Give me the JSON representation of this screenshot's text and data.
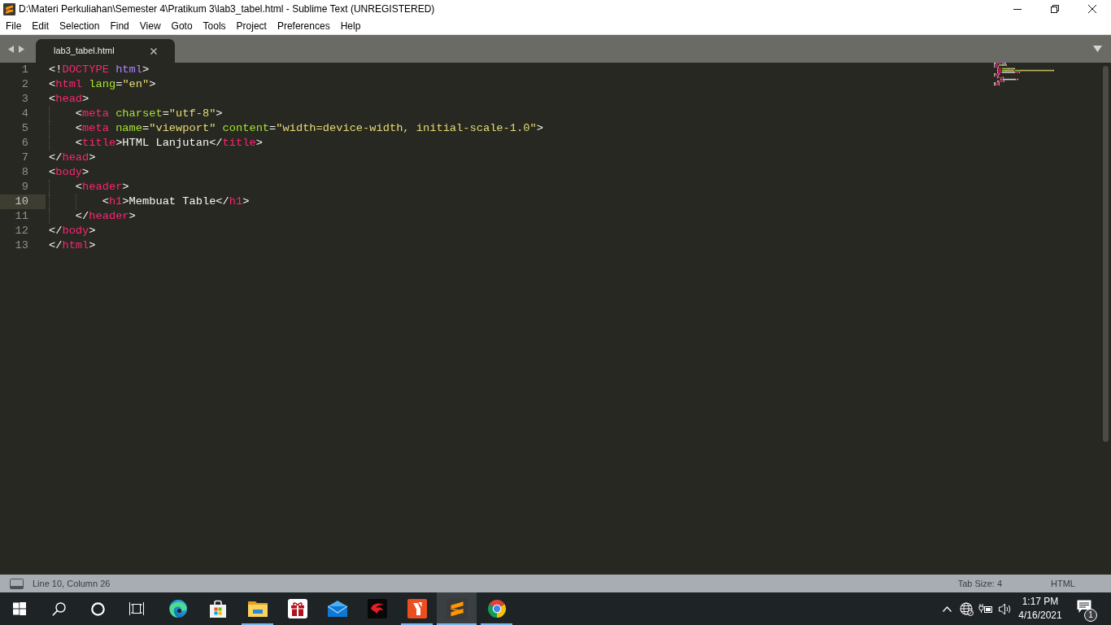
{
  "window": {
    "title": "D:\\Materi Perkuliahan\\Semester 4\\Pratikum 3\\lab3_tabel.html - Sublime Text (UNREGISTERED)"
  },
  "menu": [
    "File",
    "Edit",
    "Selection",
    "Find",
    "View",
    "Goto",
    "Tools",
    "Project",
    "Preferences",
    "Help"
  ],
  "tabs": [
    {
      "label": "lab3_tabel.html",
      "selected": true
    }
  ],
  "code": {
    "lines": [
      {
        "number": "1",
        "current": false,
        "tokens": [
          {
            "kind": "punct",
            "text": "<!"
          },
          {
            "kind": "tag",
            "text": "DOCTYPE"
          },
          {
            "kind": "keyword",
            "text": " html"
          },
          {
            "kind": "punct",
            "text": ">"
          }
        ]
      },
      {
        "number": "2",
        "current": false,
        "tokens": [
          {
            "kind": "punct",
            "text": "<"
          },
          {
            "kind": "tag",
            "text": "html"
          },
          {
            "kind": "attr",
            "text": " lang"
          },
          {
            "kind": "punct",
            "text": "="
          },
          {
            "kind": "string",
            "text": "\"en\""
          },
          {
            "kind": "punct",
            "text": ">"
          }
        ]
      },
      {
        "number": "3",
        "current": false,
        "tokens": [
          {
            "kind": "punct",
            "text": "<"
          },
          {
            "kind": "tag",
            "text": "head"
          },
          {
            "kind": "punct",
            "text": ">"
          }
        ],
        "children": [
          {
            "number": "4",
            "current": false,
            "tokens": [
              {
                "kind": "punct",
                "text": "<"
              },
              {
                "kind": "tag",
                "text": "meta"
              },
              {
                "kind": "attr",
                "text": " charset"
              },
              {
                "kind": "punct",
                "text": "="
              },
              {
                "kind": "string",
                "text": "\"utf-8\""
              },
              {
                "kind": "punct",
                "text": ">"
              }
            ]
          },
          {
            "number": "5",
            "current": false,
            "tokens": [
              {
                "kind": "punct",
                "text": "<"
              },
              {
                "kind": "tag",
                "text": "meta"
              },
              {
                "kind": "attr",
                "text": " name"
              },
              {
                "kind": "punct",
                "text": "="
              },
              {
                "kind": "string",
                "text": "\"viewport\""
              },
              {
                "kind": "attr",
                "text": " content"
              },
              {
                "kind": "punct",
                "text": "="
              },
              {
                "kind": "string",
                "text": "\"width=device-width, initial-scale-1.0\""
              },
              {
                "kind": "punct",
                "text": ">"
              }
            ]
          },
          {
            "number": "6",
            "current": false,
            "tokens": [
              {
                "kind": "punct",
                "text": "<"
              },
              {
                "kind": "tag",
                "text": "title"
              },
              {
                "kind": "punct",
                "text": ">"
              },
              {
                "kind": "text",
                "text": "HTML Lanjutan"
              },
              {
                "kind": "punct",
                "text": "</"
              },
              {
                "kind": "tag",
                "text": "title"
              },
              {
                "kind": "punct",
                "text": ">"
              }
            ]
          }
        ]
      },
      {
        "number": "7",
        "current": false,
        "tokens": [
          {
            "kind": "punct",
            "text": "</"
          },
          {
            "kind": "tag",
            "text": "head"
          },
          {
            "kind": "punct",
            "text": ">"
          }
        ]
      },
      {
        "number": "8",
        "current": false,
        "tokens": [
          {
            "kind": "punct",
            "text": "<"
          },
          {
            "kind": "tag",
            "text": "body"
          },
          {
            "kind": "punct",
            "text": ">"
          }
        ],
        "children": [
          {
            "number": "9",
            "current": false,
            "tokens": [
              {
                "kind": "punct",
                "text": "<"
              },
              {
                "kind": "tag",
                "text": "header"
              },
              {
                "kind": "punct",
                "text": ">"
              }
            ],
            "children": [
              {
                "number": "10",
                "current": true,
                "tokens": [
                  {
                    "kind": "punct",
                    "text": "<"
                  },
                  {
                    "kind": "tag",
                    "text": "h1"
                  },
                  {
                    "kind": "punct",
                    "text": ">"
                  },
                  {
                    "kind": "text",
                    "text": "Membuat Table"
                  },
                  {
                    "kind": "punct",
                    "text": "</"
                  },
                  {
                    "kind": "tag",
                    "text": "h1"
                  },
                  {
                    "kind": "punct",
                    "text": ">"
                  }
                ]
              }
            ]
          },
          {
            "number": "11",
            "current": false,
            "tokens": [
              {
                "kind": "punct",
                "text": "</"
              },
              {
                "kind": "tag",
                "text": "header"
              },
              {
                "kind": "punct",
                "text": ">"
              }
            ]
          }
        ]
      },
      {
        "number": "12",
        "current": false,
        "tokens": [
          {
            "kind": "punct",
            "text": "</"
          },
          {
            "kind": "tag",
            "text": "body"
          },
          {
            "kind": "punct",
            "text": ">"
          }
        ]
      },
      {
        "number": "13",
        "current": false,
        "tokens": [
          {
            "kind": "punct",
            "text": "</"
          },
          {
            "kind": "tag",
            "text": "html"
          },
          {
            "kind": "punct",
            "text": ">"
          }
        ]
      }
    ]
  },
  "status_bar": {
    "position": "Line 10, Column 26",
    "tab_size": "Tab Size: 4",
    "syntax": "HTML"
  },
  "taskbar": {
    "apps": [
      {
        "kind": "edge",
        "running": false,
        "selected": false
      },
      {
        "kind": "store",
        "running": false,
        "selected": false
      },
      {
        "kind": "explorer",
        "running": true,
        "selected": false
      },
      {
        "kind": "gift",
        "running": false,
        "selected": false
      },
      {
        "kind": "mail",
        "running": false,
        "selected": false
      },
      {
        "kind": "dragon",
        "running": false,
        "selected": false
      },
      {
        "kind": "document",
        "running": true,
        "selected": false
      },
      {
        "kind": "sublime",
        "running": true,
        "selected": true
      },
      {
        "kind": "chrome",
        "running": true,
        "selected": false
      }
    ],
    "clock": {
      "time": "1:17 PM",
      "date": "4/16/2021"
    },
    "notifications": {
      "count": "1"
    }
  }
}
